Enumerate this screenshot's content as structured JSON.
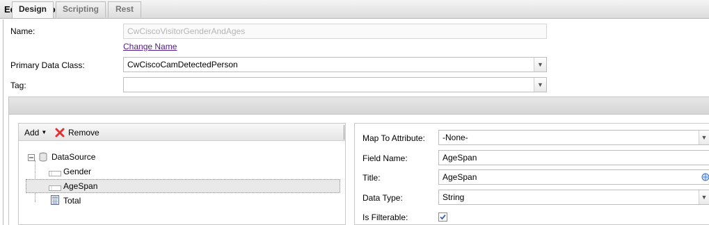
{
  "window": {
    "title": "Edit data source"
  },
  "form": {
    "name_label": "Name:",
    "name_value": "CwCiscoVisitorGenderAndAges",
    "change_name_link": "Change Name",
    "primary_class_label": "Primary Data Class:",
    "primary_class_value": "CwCiscoCamDetectedPerson",
    "tag_label": "Tag:",
    "tag_value": ""
  },
  "tabs": [
    {
      "label": "Design",
      "active": true
    },
    {
      "label": "Scripting",
      "active": false
    },
    {
      "label": "Rest",
      "active": false
    }
  ],
  "tree_toolbar": {
    "add_label": "Add",
    "remove_label": "Remove"
  },
  "tree": {
    "root": "DataSource",
    "children": [
      {
        "label": "Gender",
        "selected": false
      },
      {
        "label": "AgeSpan",
        "selected": true
      },
      {
        "label": "Total",
        "selected": false
      }
    ]
  },
  "properties": {
    "map_to_attribute_label": "Map To Attribute:",
    "map_to_attribute_value": "-None-",
    "field_name_label": "Field Name:",
    "field_name_value": "AgeSpan",
    "title_label": "Title:",
    "title_value": "AgeSpan",
    "data_type_label": "Data Type:",
    "data_type_value": "String",
    "is_filterable_label": "Is Filterable:",
    "is_filterable_checked": true
  },
  "colors": {
    "link": "#551a8b",
    "remove_icon": "#e03030",
    "checkbox": "#3a5da8"
  }
}
